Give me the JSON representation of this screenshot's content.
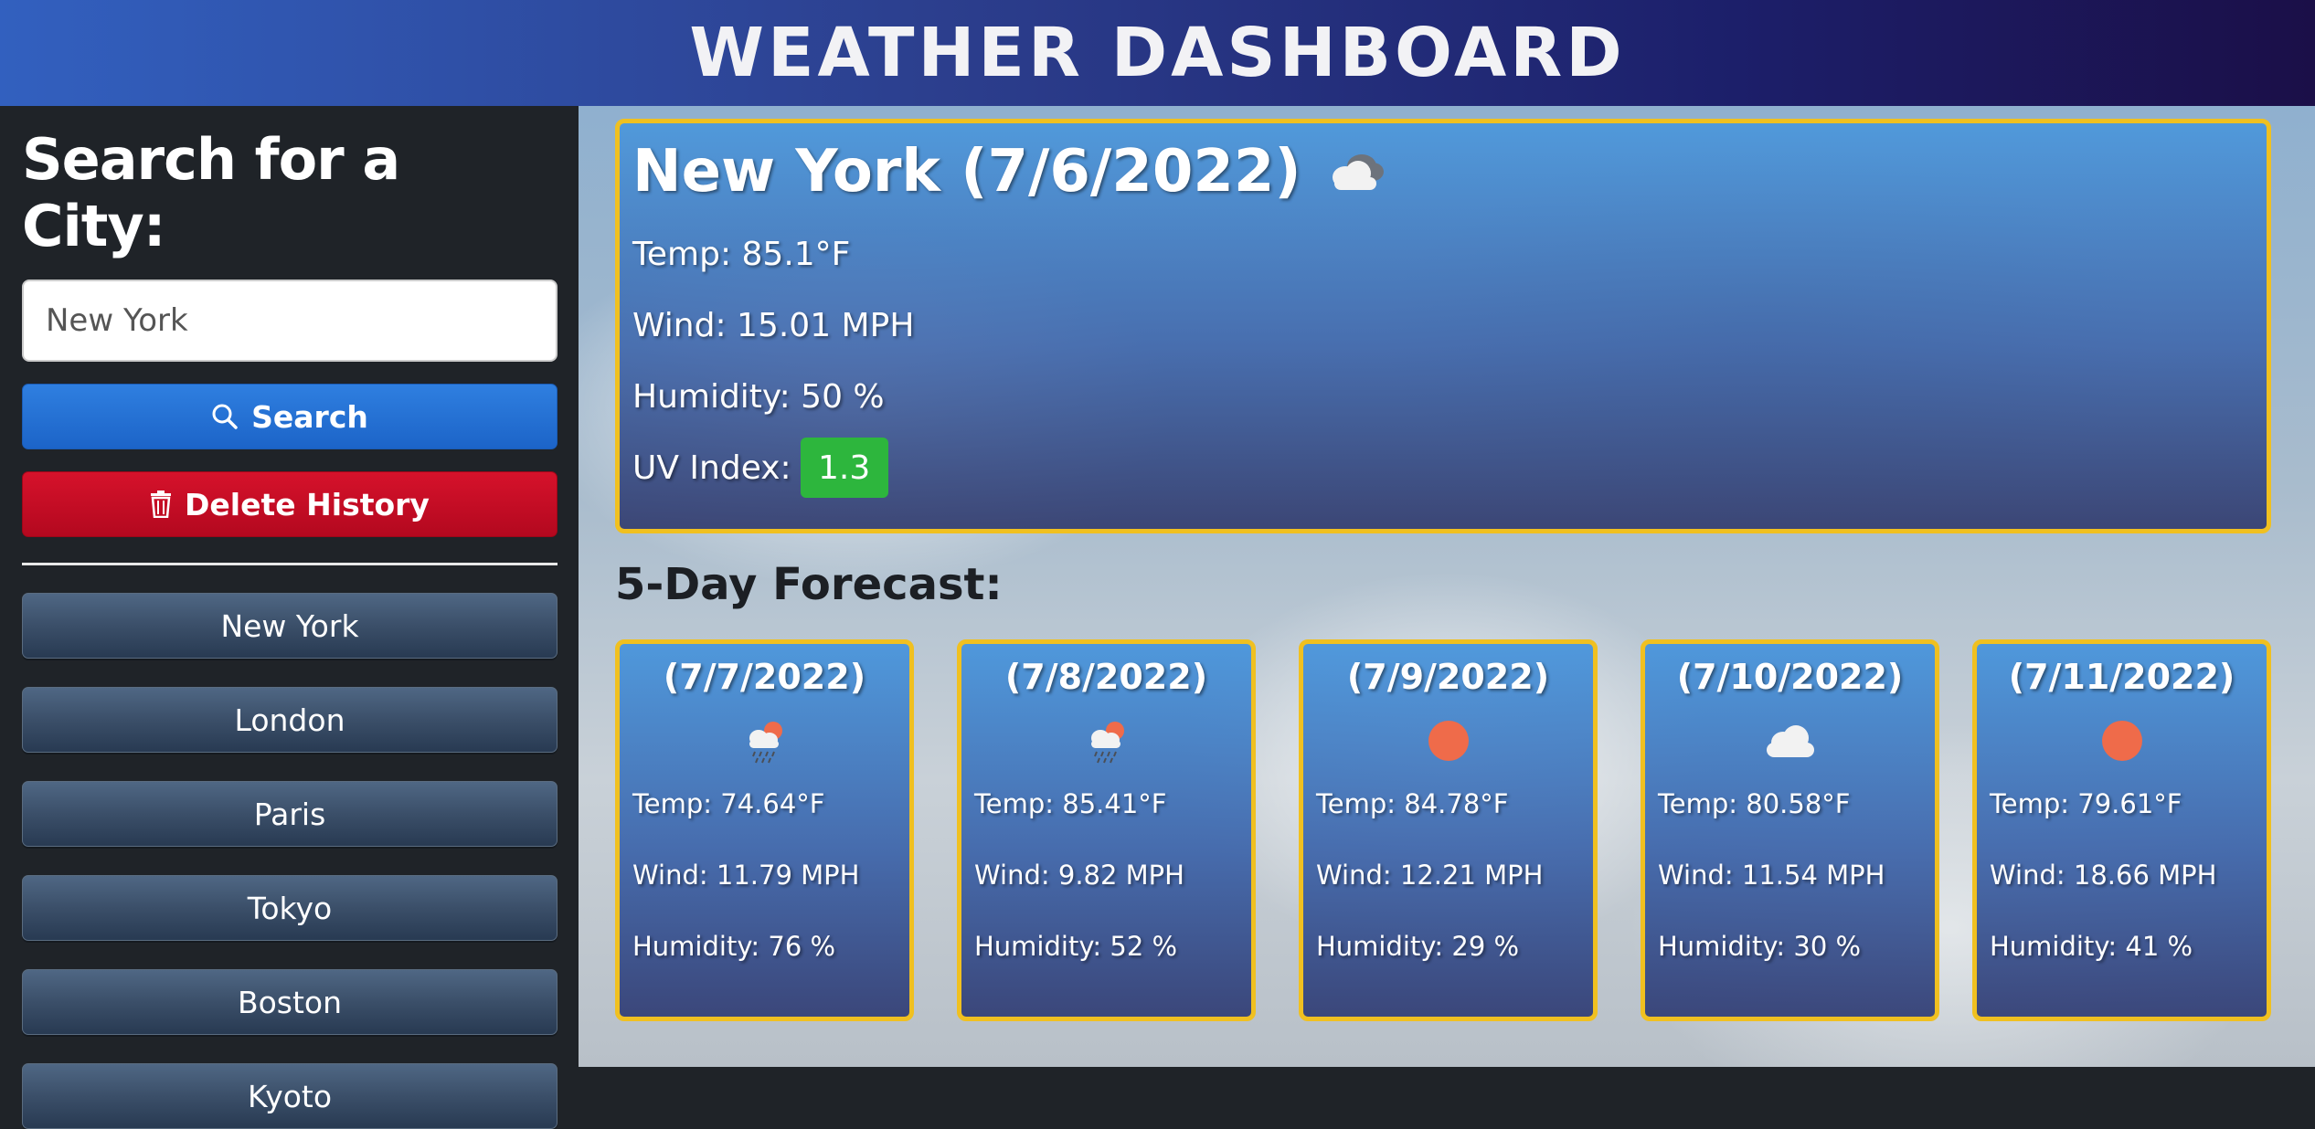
{
  "header": {
    "title": "WEATHER DASHBOARD"
  },
  "sidebar": {
    "heading": "Search for a City:",
    "search_value": "New York",
    "search_button": "Search",
    "delete_button": "Delete History",
    "history": [
      "New York",
      "London",
      "Paris",
      "Tokyo",
      "Boston",
      "Kyoto"
    ]
  },
  "current": {
    "title": "New York (7/6/2022)",
    "icon": "cloudy-icon",
    "temp": "Temp: 85.1°F",
    "wind": "Wind: 15.01 MPH",
    "humidity": "Humidity: 50 %",
    "uv_label": "UV Index:",
    "uv_value": "1.3"
  },
  "forecast": {
    "heading": "5-Day Forecast:",
    "days": [
      {
        "date": "(7/7/2022)",
        "icon": "rain-sun-icon",
        "temp": "Temp: 74.64°F",
        "wind": "Wind: 11.79 MPH",
        "humidity": "Humidity: 76 %"
      },
      {
        "date": "(7/8/2022)",
        "icon": "rain-sun-icon",
        "temp": "Temp: 85.41°F",
        "wind": "Wind: 9.82 MPH",
        "humidity": "Humidity: 52 %"
      },
      {
        "date": "(7/9/2022)",
        "icon": "sun-icon",
        "temp": "Temp: 84.78°F",
        "wind": "Wind: 12.21 MPH",
        "humidity": "Humidity: 29 %"
      },
      {
        "date": "(7/10/2022)",
        "icon": "cloud-icon",
        "temp": "Temp: 80.58°F",
        "wind": "Wind: 11.54 MPH",
        "humidity": "Humidity: 30 %"
      },
      {
        "date": "(7/11/2022)",
        "icon": "sun-icon",
        "temp": "Temp: 79.61°F",
        "wind": "Wind: 18.66 MPH",
        "humidity": "Humidity: 41 %"
      }
    ]
  },
  "colors": {
    "accent_border": "#f0c020",
    "uv_green": "#2db63d",
    "search_blue": "#1c64c8",
    "delete_red": "#c30b24"
  }
}
